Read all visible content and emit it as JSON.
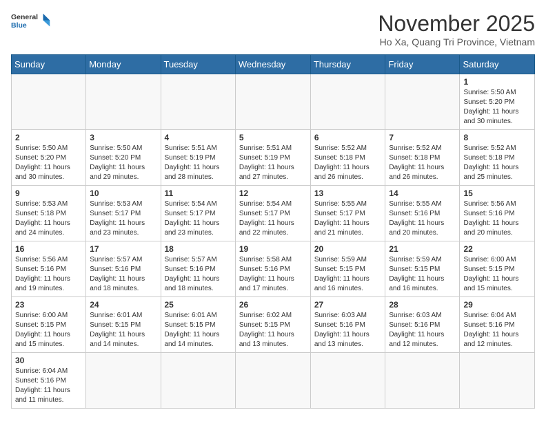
{
  "header": {
    "logo_general": "General",
    "logo_blue": "Blue",
    "month_title": "November 2025",
    "location": "Ho Xa, Quang Tri Province, Vietnam"
  },
  "days_of_week": [
    "Sunday",
    "Monday",
    "Tuesday",
    "Wednesday",
    "Thursday",
    "Friday",
    "Saturday"
  ],
  "weeks": [
    [
      {
        "day": "",
        "content": ""
      },
      {
        "day": "",
        "content": ""
      },
      {
        "day": "",
        "content": ""
      },
      {
        "day": "",
        "content": ""
      },
      {
        "day": "",
        "content": ""
      },
      {
        "day": "",
        "content": ""
      },
      {
        "day": "1",
        "content": "Sunrise: 5:50 AM\nSunset: 5:20 PM\nDaylight: 11 hours and 30 minutes."
      }
    ],
    [
      {
        "day": "2",
        "content": "Sunrise: 5:50 AM\nSunset: 5:20 PM\nDaylight: 11 hours and 30 minutes."
      },
      {
        "day": "3",
        "content": "Sunrise: 5:50 AM\nSunset: 5:20 PM\nDaylight: 11 hours and 29 minutes."
      },
      {
        "day": "4",
        "content": "Sunrise: 5:51 AM\nSunset: 5:19 PM\nDaylight: 11 hours and 28 minutes."
      },
      {
        "day": "5",
        "content": "Sunrise: 5:51 AM\nSunset: 5:19 PM\nDaylight: 11 hours and 27 minutes."
      },
      {
        "day": "6",
        "content": "Sunrise: 5:52 AM\nSunset: 5:18 PM\nDaylight: 11 hours and 26 minutes."
      },
      {
        "day": "7",
        "content": "Sunrise: 5:52 AM\nSunset: 5:18 PM\nDaylight: 11 hours and 26 minutes."
      },
      {
        "day": "8",
        "content": "Sunrise: 5:52 AM\nSunset: 5:18 PM\nDaylight: 11 hours and 25 minutes."
      }
    ],
    [
      {
        "day": "9",
        "content": "Sunrise: 5:53 AM\nSunset: 5:18 PM\nDaylight: 11 hours and 24 minutes."
      },
      {
        "day": "10",
        "content": "Sunrise: 5:53 AM\nSunset: 5:17 PM\nDaylight: 11 hours and 23 minutes."
      },
      {
        "day": "11",
        "content": "Sunrise: 5:54 AM\nSunset: 5:17 PM\nDaylight: 11 hours and 23 minutes."
      },
      {
        "day": "12",
        "content": "Sunrise: 5:54 AM\nSunset: 5:17 PM\nDaylight: 11 hours and 22 minutes."
      },
      {
        "day": "13",
        "content": "Sunrise: 5:55 AM\nSunset: 5:17 PM\nDaylight: 11 hours and 21 minutes."
      },
      {
        "day": "14",
        "content": "Sunrise: 5:55 AM\nSunset: 5:16 PM\nDaylight: 11 hours and 20 minutes."
      },
      {
        "day": "15",
        "content": "Sunrise: 5:56 AM\nSunset: 5:16 PM\nDaylight: 11 hours and 20 minutes."
      }
    ],
    [
      {
        "day": "16",
        "content": "Sunrise: 5:56 AM\nSunset: 5:16 PM\nDaylight: 11 hours and 19 minutes."
      },
      {
        "day": "17",
        "content": "Sunrise: 5:57 AM\nSunset: 5:16 PM\nDaylight: 11 hours and 18 minutes."
      },
      {
        "day": "18",
        "content": "Sunrise: 5:57 AM\nSunset: 5:16 PM\nDaylight: 11 hours and 18 minutes."
      },
      {
        "day": "19",
        "content": "Sunrise: 5:58 AM\nSunset: 5:16 PM\nDaylight: 11 hours and 17 minutes."
      },
      {
        "day": "20",
        "content": "Sunrise: 5:59 AM\nSunset: 5:15 PM\nDaylight: 11 hours and 16 minutes."
      },
      {
        "day": "21",
        "content": "Sunrise: 5:59 AM\nSunset: 5:15 PM\nDaylight: 11 hours and 16 minutes."
      },
      {
        "day": "22",
        "content": "Sunrise: 6:00 AM\nSunset: 5:15 PM\nDaylight: 11 hours and 15 minutes."
      }
    ],
    [
      {
        "day": "23",
        "content": "Sunrise: 6:00 AM\nSunset: 5:15 PM\nDaylight: 11 hours and 15 minutes."
      },
      {
        "day": "24",
        "content": "Sunrise: 6:01 AM\nSunset: 5:15 PM\nDaylight: 11 hours and 14 minutes."
      },
      {
        "day": "25",
        "content": "Sunrise: 6:01 AM\nSunset: 5:15 PM\nDaylight: 11 hours and 14 minutes."
      },
      {
        "day": "26",
        "content": "Sunrise: 6:02 AM\nSunset: 5:15 PM\nDaylight: 11 hours and 13 minutes."
      },
      {
        "day": "27",
        "content": "Sunrise: 6:03 AM\nSunset: 5:16 PM\nDaylight: 11 hours and 13 minutes."
      },
      {
        "day": "28",
        "content": "Sunrise: 6:03 AM\nSunset: 5:16 PM\nDaylight: 11 hours and 12 minutes."
      },
      {
        "day": "29",
        "content": "Sunrise: 6:04 AM\nSunset: 5:16 PM\nDaylight: 11 hours and 12 minutes."
      }
    ],
    [
      {
        "day": "30",
        "content": "Sunrise: 6:04 AM\nSunset: 5:16 PM\nDaylight: 11 hours and 11 minutes."
      },
      {
        "day": "",
        "content": ""
      },
      {
        "day": "",
        "content": ""
      },
      {
        "day": "",
        "content": ""
      },
      {
        "day": "",
        "content": ""
      },
      {
        "day": "",
        "content": ""
      },
      {
        "day": "",
        "content": ""
      }
    ]
  ]
}
